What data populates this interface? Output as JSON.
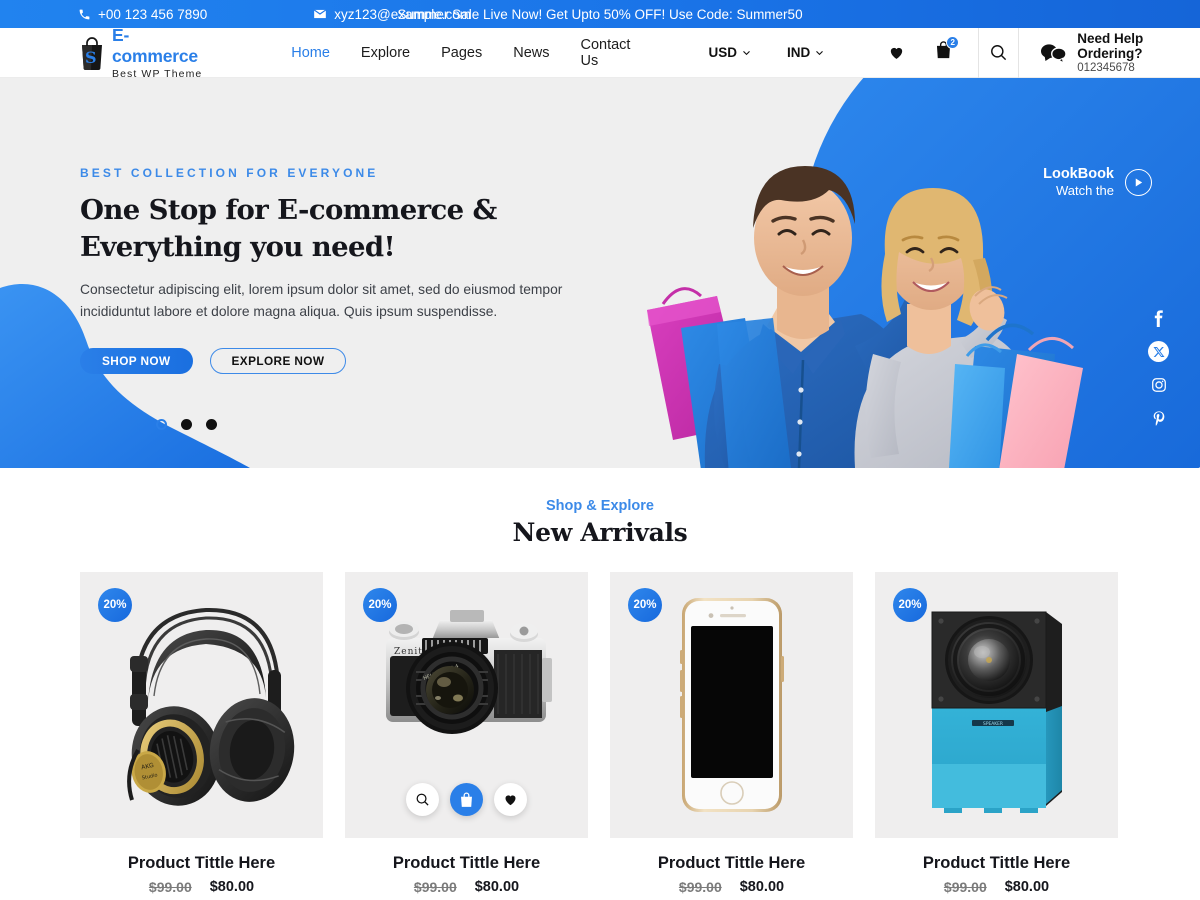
{
  "topbar": {
    "phone": "+00 123 456 7890",
    "email": "xyz123@example.com",
    "promo": "Summer Sale Live Now! Get Upto 50% OFF! Use Code: Summer50"
  },
  "header": {
    "logo_main_blue": "E-commerce",
    "logo_main_dark": "",
    "logo_tagline": "Best WP Theme",
    "nav": [
      {
        "label": "Home",
        "active": true
      },
      {
        "label": "Explore",
        "active": false
      },
      {
        "label": "Pages",
        "active": false
      },
      {
        "label": "News",
        "active": false
      },
      {
        "label": "Contact Us",
        "active": false
      }
    ],
    "currency": "USD",
    "country": "IND",
    "cart_count": "2",
    "help_title": "Need Help Ordering?",
    "help_phone": "012345678"
  },
  "hero": {
    "eyebrow": "BEST COLLECTION FOR EVERYONE",
    "heading": "One Stop for E-commerce & Everything you need!",
    "paragraph": "Consectetur adipiscing elit, lorem ipsum dolor sit amet, sed do eiusmod tempor incididuntut labore et dolore magna aliqua. Quis ipsum suspendisse.",
    "btn_primary": "SHOP NOW",
    "btn_outline": "EXPLORE NOW",
    "lookbook_line1": "LookBook",
    "lookbook_line2": "Watch the",
    "socials": [
      "facebook-icon",
      "x-twitter-icon",
      "instagram-icon",
      "pinterest-icon"
    ],
    "slides": 3,
    "active_slide": 1,
    "accent_color": "#2a7fe8",
    "bg_color": "#efefef"
  },
  "arrivals": {
    "subtitle": "Shop & Explore",
    "title": "New Arrivals",
    "products": [
      {
        "title": "Product Tittle Here",
        "old_price": "$99.00",
        "new_price": "$80.00",
        "discount": "20%",
        "image": "headphones",
        "hover_visible": false
      },
      {
        "title": "Product Tittle Here",
        "old_price": "$99.00",
        "new_price": "$80.00",
        "discount": "20%",
        "image": "camera",
        "hover_visible": true
      },
      {
        "title": "Product Tittle Here",
        "old_price": "$99.00",
        "new_price": "$80.00",
        "discount": "20%",
        "image": "smartphone",
        "hover_visible": false
      },
      {
        "title": "Product Tittle Here",
        "old_price": "$99.00",
        "new_price": "$80.00",
        "discount": "20%",
        "image": "speaker",
        "hover_visible": false
      }
    ],
    "hover_actions": [
      "search-icon",
      "cart-icon",
      "heart-icon"
    ]
  }
}
